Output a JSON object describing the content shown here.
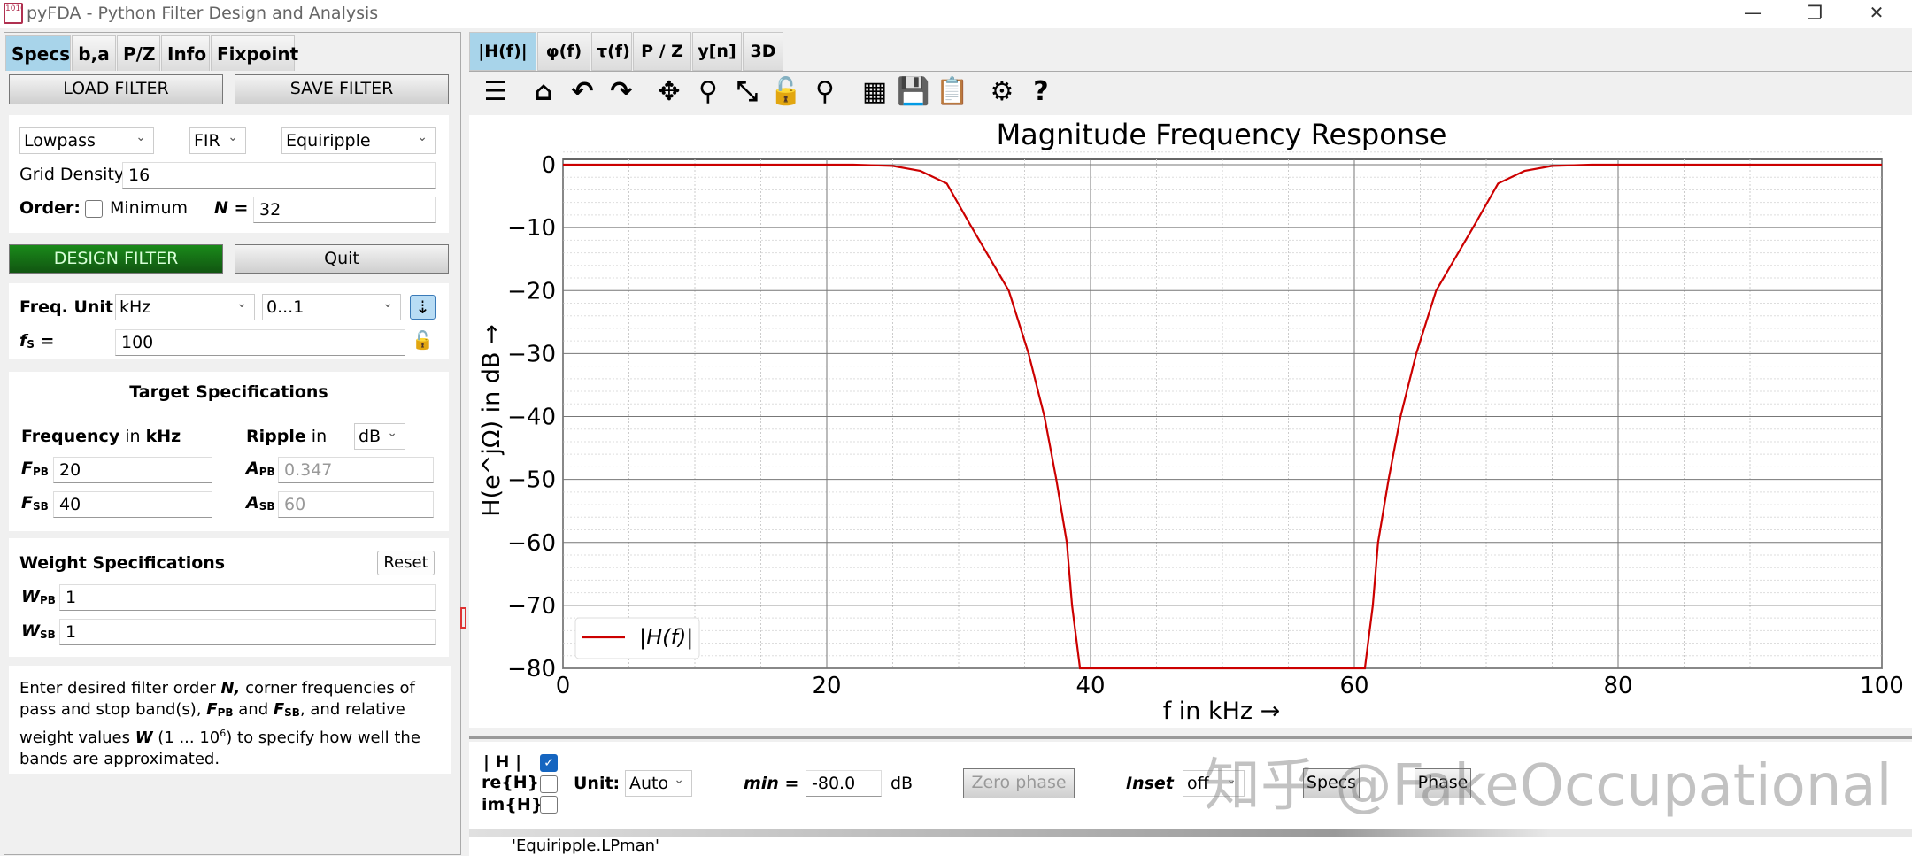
{
  "window": {
    "title": "pyFDA - Python Filter Design and Analysis",
    "logo_text": "1010",
    "controls": [
      "—",
      "❐",
      "✕"
    ]
  },
  "left": {
    "tabs": [
      "Specs",
      "b,a",
      "P/Z",
      "Info",
      "Fixpoint"
    ],
    "load": "LOAD FILTER",
    "save": "SAVE FILTER",
    "response_type": "Lowpass",
    "filter_class": "FIR",
    "design_method": "Equiripple",
    "grid_density_label": "Grid Density",
    "grid_density": "16",
    "order_label": "Order:",
    "minimum_label": "Minimum",
    "minimum_checked": false,
    "n_label": "N =",
    "n_value": "32",
    "design": "DESIGN FILTER",
    "quit": "Quit",
    "freq_unit_label": "Freq. Unit",
    "freq_unit": "kHz",
    "freq_range": "0...1",
    "fs_label": "f",
    "fs_sub": "S",
    "fs_eq": " =",
    "fs_value": "100",
    "target_title": "Target Specifications",
    "freq_hdr": "Frequency",
    "freq_in": "in",
    "freq_unit_hdr": "kHz",
    "ripple_hdr": "Ripple",
    "ripple_in": "in",
    "ripple_unit": "dB",
    "fpb_label": "F",
    "fpb_sub": "PB",
    "fpb": "20",
    "fsb_label": "F",
    "fsb_sub": "SB",
    "fsb": "40",
    "apb_label": "A",
    "apb_sub": "PB",
    "apb": "0.347",
    "asb_label": "A",
    "asb_sub": "SB",
    "asb": "60",
    "weight_title": "Weight Specifications",
    "reset": "Reset",
    "wpb_label": "W",
    "wpb_sub": "PB",
    "wpb": "1",
    "wsb_label": "W",
    "wsb_sub": "SB",
    "wsb": "1",
    "info": {
      "t1": "Enter desired filter order ",
      "n": "N,",
      "t2": " corner frequencies of pass and stop band(s), ",
      "fpb": "F",
      "fpb_sub": "PB",
      "and": " and ",
      "fsb": "F",
      "fsb_sub": "SB",
      "t3": ", and relative weight values ",
      "w": "W",
      "t4": " (1 ... 10",
      "exp": "6",
      "t5": ") to specify how well the bands are approximated."
    }
  },
  "right": {
    "tabs": [
      "|H(f)|",
      "φ(f)",
      "τ(f)",
      "P / Z",
      "y[n]",
      "3D"
    ],
    "toolbar": [
      {
        "icon": "toggle-toolbar-icon",
        "glyph": "☰"
      },
      {
        "icon": "home-icon",
        "glyph": "⌂"
      },
      {
        "icon": "undo-icon",
        "glyph": "↶"
      },
      {
        "icon": "redo-icon",
        "glyph": "↷"
      },
      {
        "icon": "pan-icon",
        "glyph": "✥"
      },
      {
        "icon": "zoom-icon",
        "glyph": "⚲"
      },
      {
        "icon": "full-view-icon",
        "glyph": "⤡"
      },
      {
        "icon": "lock-icon",
        "glyph": "🔓"
      },
      {
        "icon": "marker-icon",
        "glyph": "⚲"
      },
      {
        "icon": "grid-icon",
        "glyph": "▦"
      },
      {
        "icon": "save-icon",
        "glyph": "💾"
      },
      {
        "icon": "clipboard-icon",
        "glyph": "📋"
      },
      {
        "icon": "settings-icon",
        "glyph": "⚙"
      },
      {
        "icon": "help-icon",
        "glyph": "?"
      }
    ],
    "controls": {
      "h_label": "| H |",
      "h_checked": true,
      "re_label": "re{H}",
      "im_label": "im{H}",
      "unit_label": "Unit:",
      "unit": "Auto",
      "min_label": "min =",
      "min_value": "-80.0",
      "db": "dB",
      "zero_phase": "Zero phase",
      "inset_label": "Inset",
      "inset": "off",
      "specs": "Specs",
      "phase": "Phase"
    },
    "status": "'Equiripple.LPman'",
    "watermark": "知乎 @FakeOccupational"
  },
  "chart_data": {
    "type": "line",
    "title": "Magnitude Frequency Response",
    "xlabel": "f in kHz →",
    "ylabel": "H(e^jΩ) in dB →",
    "xlim": [
      0,
      100
    ],
    "ylim": [
      -80,
      2
    ],
    "xticks": [
      0,
      20,
      40,
      60,
      80,
      100
    ],
    "yticks": [
      0,
      -10,
      -20,
      -30,
      -40,
      -50,
      -60,
      -70,
      -80
    ],
    "grid": true,
    "legend_position": "lower-left",
    "series": [
      {
        "name": "|H(f)|",
        "color": "#cc0000",
        "x": [
          0,
          22,
          25,
          27.1,
          29.1,
          31.0,
          33.8,
          35.3,
          36.5,
          37.4,
          38.2,
          38.6,
          39.2,
          60.8,
          61.4,
          61.8,
          62.6,
          63.5,
          64.7,
          66.2,
          69.0,
          70.9,
          72.9,
          75,
          78,
          100
        ],
        "y": [
          0,
          0,
          -0.2,
          -1,
          -3,
          -10,
          -20,
          -30,
          -40,
          -50,
          -60,
          -70,
          -80,
          -80,
          -70,
          -60,
          -50,
          -40,
          -30,
          -20,
          -10,
          -3,
          -1,
          -0.2,
          0,
          0
        ]
      }
    ]
  }
}
